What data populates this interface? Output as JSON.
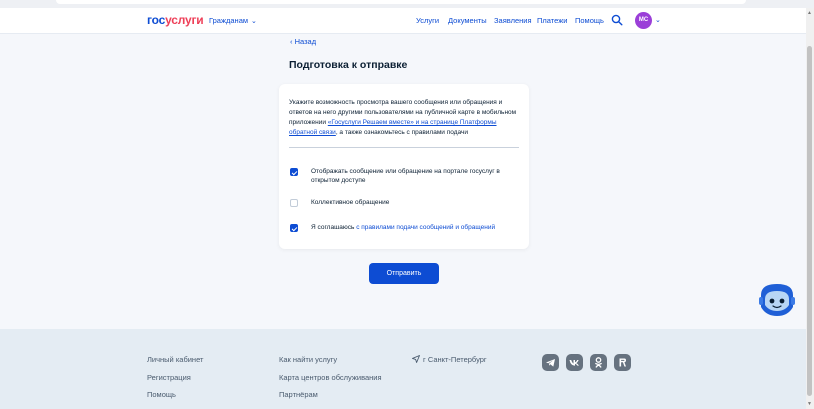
{
  "header": {
    "logo_part1": "гос",
    "logo_part2": "услуги",
    "audience": "Гражданам",
    "nav": [
      "Услуги",
      "Документы",
      "Заявления",
      "Платежи",
      "Помощь"
    ],
    "avatar_initials": "МС"
  },
  "main": {
    "back_label": "Назад",
    "title": "Подготовка к отправке",
    "intro_text_1": "Укажите возможность просмотра вашего сообщения или обращения и ответов на него другими пользователями на публичной карте в мобильном приложении ",
    "intro_link": "«Госуслуги Решаем вместе» и на странице Платформы обратной связи",
    "intro_text_2": ", а также ознакомьтесь с правилами подачи",
    "options": [
      {
        "label": "Отображать сообщение или обращение на портале госуслуг в открытом доступе",
        "checked": true
      },
      {
        "label": "Коллективное обращение",
        "checked": false
      },
      {
        "label_prefix": "Я соглашаюсь ",
        "label_link": "с правилами подачи сообщений и обращений",
        "checked": true
      }
    ],
    "submit_label": "Отправить"
  },
  "footer": {
    "col1": [
      "Личный кабинет",
      "Регистрация",
      "Помощь"
    ],
    "col2": [
      "Как найти услугу",
      "Карта центров обслуживания",
      "Партнёрам"
    ],
    "location": "г Санкт-Петербург",
    "social": [
      "telegram-icon",
      "vk-icon",
      "odnoklassniki-icon",
      "rutube-icon"
    ]
  },
  "colors": {
    "accent": "#0d4cd3",
    "brand_red": "#ee3f58",
    "background": "#f5f7fb",
    "footer_bg": "#e4ecf3"
  }
}
